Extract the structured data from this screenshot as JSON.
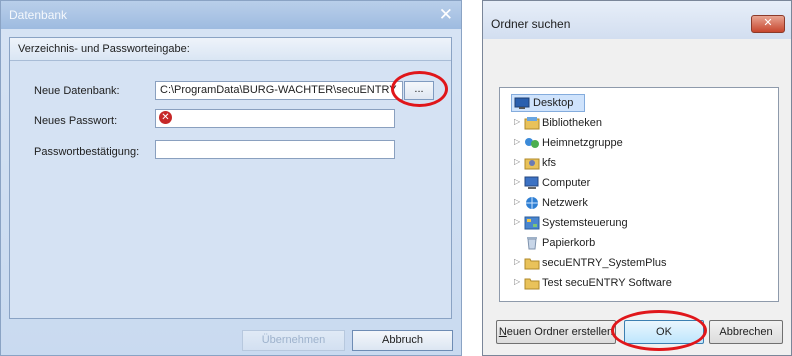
{
  "left_dialog": {
    "title": "Datenbank",
    "close_glyph": "✕",
    "group_title": "Verzeichnis- und Passworteingabe:",
    "fields": {
      "db_label": "Neue Datenbank:",
      "db_value": "C:\\ProgramData\\BURG-WACHTER\\secuENTRY",
      "browse_label": "...",
      "pw_label": "Neues Passwort:",
      "pw_value": "",
      "confirm_label": "Passwortbestätigung:",
      "confirm_value": ""
    },
    "error_glyph": "✕",
    "buttons": {
      "apply": "Übernehmen",
      "cancel": "Abbruch"
    }
  },
  "right_dialog": {
    "title": "Ordner suchen",
    "close_glyph": "✕",
    "tree": [
      {
        "label": "Desktop",
        "icon": "desktop-icon",
        "selected": true,
        "expandable": false
      },
      {
        "label": "Bibliotheken",
        "icon": "libraries-icon",
        "expandable": true
      },
      {
        "label": "Heimnetzgruppe",
        "icon": "homegroup-icon",
        "expandable": true
      },
      {
        "label": "kfs",
        "icon": "user-folder-icon",
        "expandable": true
      },
      {
        "label": "Computer",
        "icon": "computer-icon",
        "expandable": true
      },
      {
        "label": "Netzwerk",
        "icon": "network-icon",
        "expandable": true
      },
      {
        "label": "Systemsteuerung",
        "icon": "control-panel-icon",
        "expandable": true
      },
      {
        "label": "Papierkorb",
        "icon": "recycle-bin-icon",
        "expandable": false
      },
      {
        "label": "secuENTRY_SystemPlus",
        "icon": "folder-icon",
        "expandable": true
      },
      {
        "label": "Test secuENTRY Software",
        "icon": "folder-icon",
        "expandable": true
      }
    ],
    "buttons": {
      "new_folder_first": "N",
      "new_folder_rest": "euen Ordner erstellen",
      "ok": "OK",
      "cancel": "Abbrechen"
    }
  },
  "colors": {
    "highlight_ring": "#e0161a",
    "selection": "#cfe3fc"
  }
}
